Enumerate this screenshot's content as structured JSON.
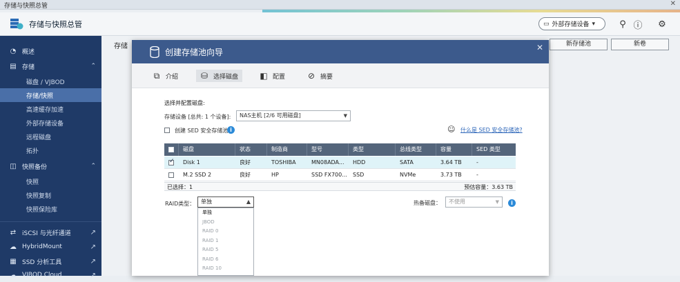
{
  "window": {
    "title": "存储与快照总管",
    "close": "✕"
  },
  "header": {
    "app_title": "存储与快照总管",
    "external_storage_btn": "外部存储设备",
    "icons": [
      "search-icon",
      "help-icon",
      "gear-icon"
    ]
  },
  "sidebar": {
    "items": [
      {
        "label": "概述",
        "icon": "gauge-icon",
        "top": 0
      },
      {
        "label": "存储",
        "icon": "storage-icon",
        "chev": "^"
      },
      {
        "label": "磁盘 / VJBOD"
      },
      {
        "label": "存储/快照"
      },
      {
        "label": "高速缓存加速"
      },
      {
        "label": "外部存储设备"
      },
      {
        "label": "远程磁盘"
      },
      {
        "label": "拓扑"
      },
      {
        "label": "快照备份",
        "icon": "snapshot-icon",
        "chev": "^"
      },
      {
        "label": "快照"
      },
      {
        "label": "快照复制"
      },
      {
        "label": "快照保险库"
      },
      {
        "label": "iSCSI 与光纤通道",
        "icon": "iscsi-icon",
        "ext": "↗"
      },
      {
        "label": "HybridMount",
        "icon": "cloud-icon",
        "ext": "↗"
      },
      {
        "label": "SSD 分析工具",
        "icon": "ssd-icon",
        "ext": "↗"
      },
      {
        "label": "VJBOD Cloud",
        "icon": "vjbod-cloud-icon",
        "ext": "↗"
      }
    ]
  },
  "main": {
    "crumb": "存储",
    "btn_new_pool": "新存储池",
    "btn_new_volume": "新卷"
  },
  "dialog": {
    "title": "创建存储池向导",
    "close": "✕",
    "steps": [
      "介绍",
      "选择磁盘",
      "配置",
      "摘要"
    ],
    "section_title": "选择并配置磁盘:",
    "storage_device_label": "存储设备 [总共: 1 个设备]:",
    "storage_device_value": "NAS主机 [2/6 可用磁盘]",
    "sed_checkbox_label": "创建 SED 安全存储池",
    "sed_link": "什么是 SED 安全存储池?",
    "table": {
      "headers": [
        "磁盘",
        "状态",
        "制造商",
        "型号",
        "类型",
        "总线类型",
        "容量",
        "SED 类型"
      ],
      "rows": [
        {
          "checked": true,
          "cells": [
            "Disk 1",
            "良好",
            "TOSHIBA",
            "MN08ADA...",
            "HDD",
            "SATA",
            "3.64 TB",
            "-"
          ]
        },
        {
          "checked": false,
          "cells": [
            "M.2 SSD 2",
            "良好",
            "HP",
            "SSD FX700...",
            "SSD",
            "NVMe",
            "3.73 TB",
            "-"
          ]
        }
      ],
      "footer_selected": "已选择：1",
      "footer_capacity": "预估容量：3.63 TB"
    },
    "raid_label": "RAID类型：",
    "raid_value": "单独",
    "hot_spare_label": "热备磁盘：",
    "hot_spare_value": "不使用",
    "raid_options": [
      "单独",
      "JBOD",
      "RAID 0",
      "RAID 1",
      "RAID 5",
      "RAID 6",
      "RAID 10"
    ]
  }
}
